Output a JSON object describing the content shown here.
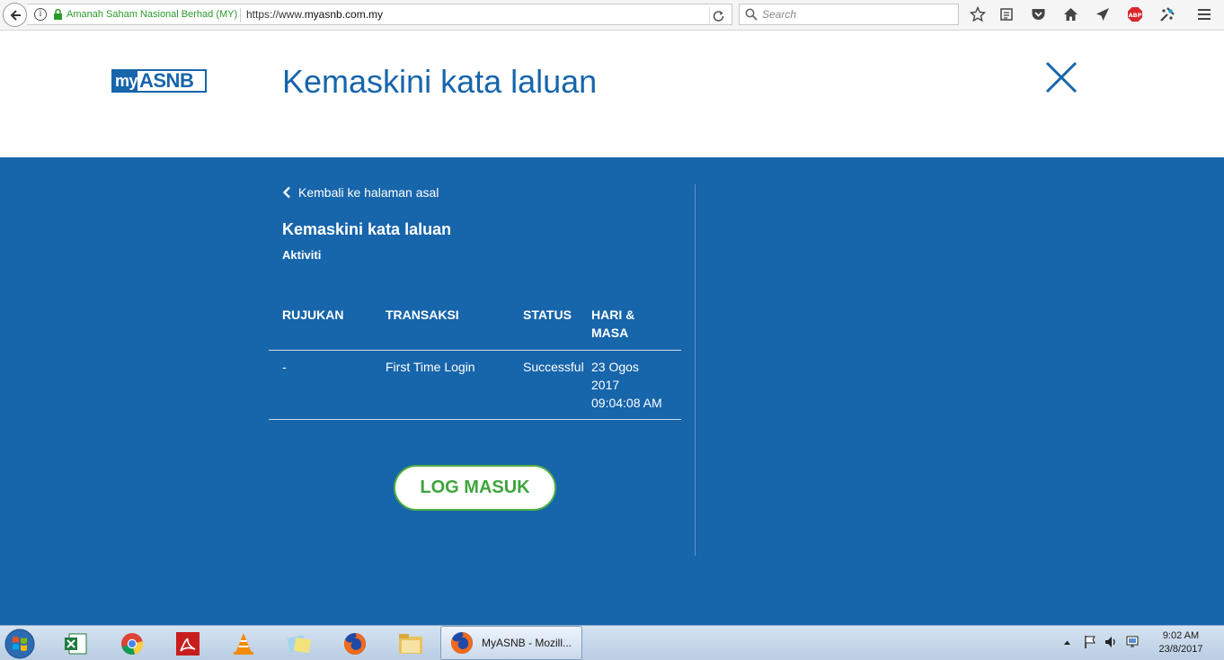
{
  "browser": {
    "site_identity": "Amanah Saham Nasional Berhad (MY)",
    "url_prefix": "https://www.",
    "url_domain": "myasnb.com.my",
    "search_placeholder": "Search"
  },
  "header": {
    "logo_my": "my",
    "logo_asnb": "ASNB",
    "title": "Kemaskini kata laluan"
  },
  "main": {
    "back_link": "Kembali ke halaman asal",
    "section_title": "Kemaskini kata laluan",
    "section_subtitle": "Aktiviti",
    "table": {
      "headers": [
        "RUJUKAN",
        "TRANSAKSI",
        "STATUS",
        "HARI & MASA"
      ],
      "rows": [
        {
          "rujukan": "-",
          "transaksi": "First Time Login",
          "status": "Successful",
          "hari_masa_line1": "23 Ogos",
          "hari_masa_line2": "2017",
          "hari_masa_line3": "09:04:08 AM"
        }
      ]
    },
    "login_button": "LOG MASUK"
  },
  "taskbar": {
    "active_task": "MyASNB - Mozill...",
    "time": "9:02 AM",
    "date": "23/8/2017"
  },
  "colors": {
    "brand_blue": "#1765ab",
    "button_green": "#3ea53d"
  }
}
